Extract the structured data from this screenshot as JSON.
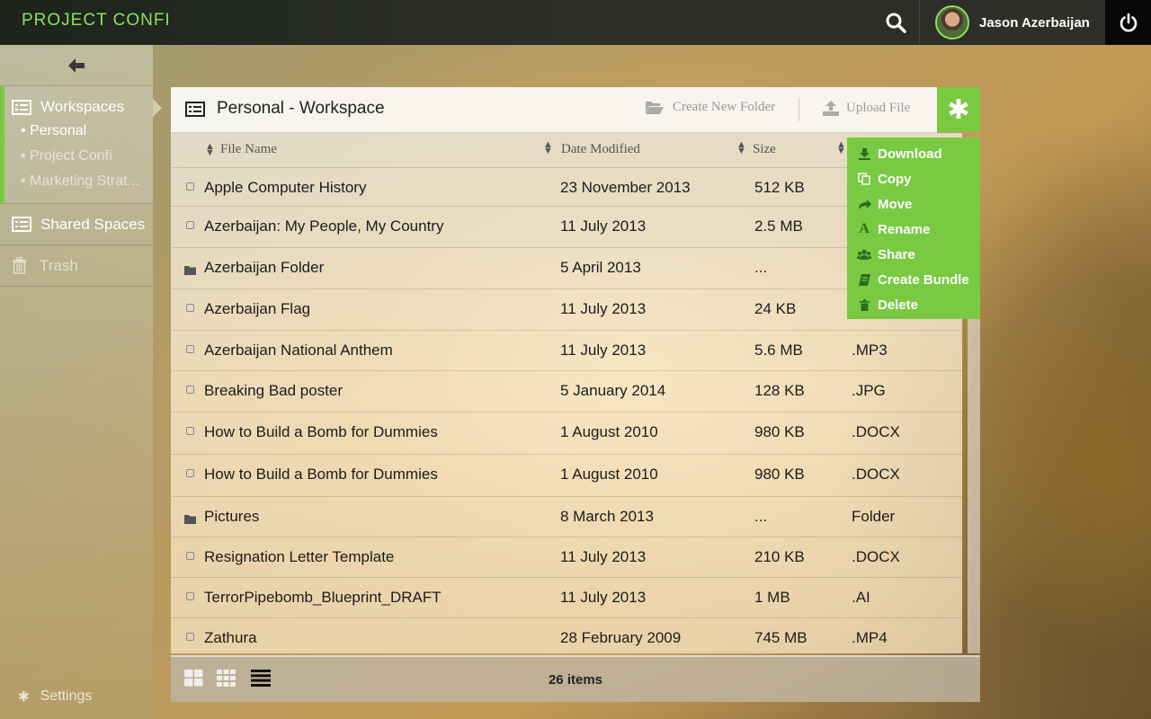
{
  "app": {
    "logo": "PROJECT CONFI"
  },
  "user": {
    "name": "Jason Azerbaijan"
  },
  "sidebar": {
    "workspaces_label": "Workspaces",
    "workspaces": [
      {
        "label": "Personal",
        "active": true
      },
      {
        "label": "Project Confi",
        "active": false
      },
      {
        "label": "Marketing Strat...",
        "active": false
      }
    ],
    "shared_label": "Shared Spaces",
    "trash_label": "Trash",
    "settings_label": "Settings"
  },
  "panel": {
    "title": "Personal - Workspace",
    "create_folder_label": "Create New Folder",
    "upload_label": "Upload File",
    "columns": {
      "name": "File Name",
      "date": "Date Modified",
      "size": "Size"
    },
    "files": [
      {
        "name": "Apple Computer History",
        "date": "23 November 2013",
        "size": "512 KB",
        "type": "",
        "folder": false
      },
      {
        "name": "Azerbaijan: My People, My Country",
        "date": "11 July 2013",
        "size": "2.5 MB",
        "type": "",
        "folder": false
      },
      {
        "name": "Azerbaijan Folder",
        "date": "5 April 2013",
        "size": "...",
        "type": "",
        "folder": true
      },
      {
        "name": "Azerbaijan Flag",
        "date": "11 July 2013",
        "size": "24 KB",
        "type": "",
        "folder": false
      },
      {
        "name": "Azerbaijan National Anthem",
        "date": "11 July 2013",
        "size": "5.6 MB",
        "type": ".MP3",
        "folder": false
      },
      {
        "name": "Breaking Bad poster",
        "date": "5 January 2014",
        "size": "128 KB",
        "type": ".JPG",
        "folder": false
      },
      {
        "name": "How to Build a Bomb for Dummies",
        "date": "1 August 2010",
        "size": "980 KB",
        "type": ".DOCX",
        "folder": false
      },
      {
        "name": "How to Build a Bomb for Dummies",
        "date": "1 August 2010",
        "size": "980 KB",
        "type": ".DOCX",
        "folder": false
      },
      {
        "name": "Pictures",
        "date": "8 March 2013",
        "size": "...",
        "type": "Folder",
        "folder": true
      },
      {
        "name": "Resignation Letter Template",
        "date": "11 July 2013",
        "size": "210 KB",
        "type": ".DOCX",
        "folder": false
      },
      {
        "name": "TerrorPipebomb_Blueprint_DRAFT",
        "date": "11 July 2013",
        "size": "1 MB",
        "type": ".AI",
        "folder": false
      },
      {
        "name": "Zathura",
        "date": "28 February 2009",
        "size": "745 MB",
        "type": ".MP4",
        "folder": false
      }
    ],
    "item_count": "26 items"
  },
  "context_menu": {
    "items": [
      {
        "label": "Download",
        "icon": "download-icon"
      },
      {
        "label": "Copy",
        "icon": "copy-icon"
      },
      {
        "label": "Move",
        "icon": "move-icon"
      },
      {
        "label": "Rename",
        "icon": "rename-icon"
      },
      {
        "label": "Share",
        "icon": "share-icon"
      },
      {
        "label": "Create Bundle",
        "icon": "bundle-icon"
      },
      {
        "label": "Delete",
        "icon": "delete-icon"
      }
    ]
  },
  "colors": {
    "accent": "#7ac943",
    "topbar": "#2c2f28",
    "logo": "#8ee05a"
  }
}
